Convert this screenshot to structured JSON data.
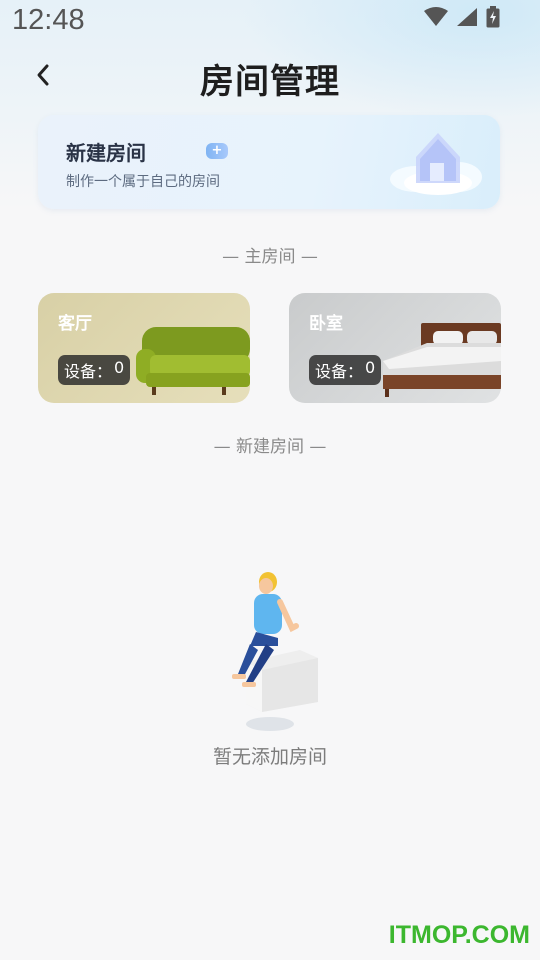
{
  "status_bar": {
    "time": "12:48",
    "icons": [
      "wifi-icon",
      "signal-icon",
      "battery-icon"
    ]
  },
  "nav": {
    "back_icon": "chevron-left-icon",
    "title": "房间管理"
  },
  "new_room_card": {
    "title": "新建房间",
    "badge": "+",
    "subtitle": "制作一个属于自己的房间"
  },
  "sections": {
    "main_rooms": "— 主房间 —",
    "new_rooms": "— 新建房间 —"
  },
  "rooms": [
    {
      "name": "客厅",
      "device_label": "设备：",
      "device_count": "0"
    },
    {
      "name": "卧室",
      "device_label": "设备：",
      "device_count": "0"
    }
  ],
  "empty_state": {
    "text": "暂无添加房间"
  },
  "watermark": "ITMOP.COM",
  "colors": {
    "accent_green": "#3cb72f",
    "badge_blue": "#7fb4f3"
  }
}
